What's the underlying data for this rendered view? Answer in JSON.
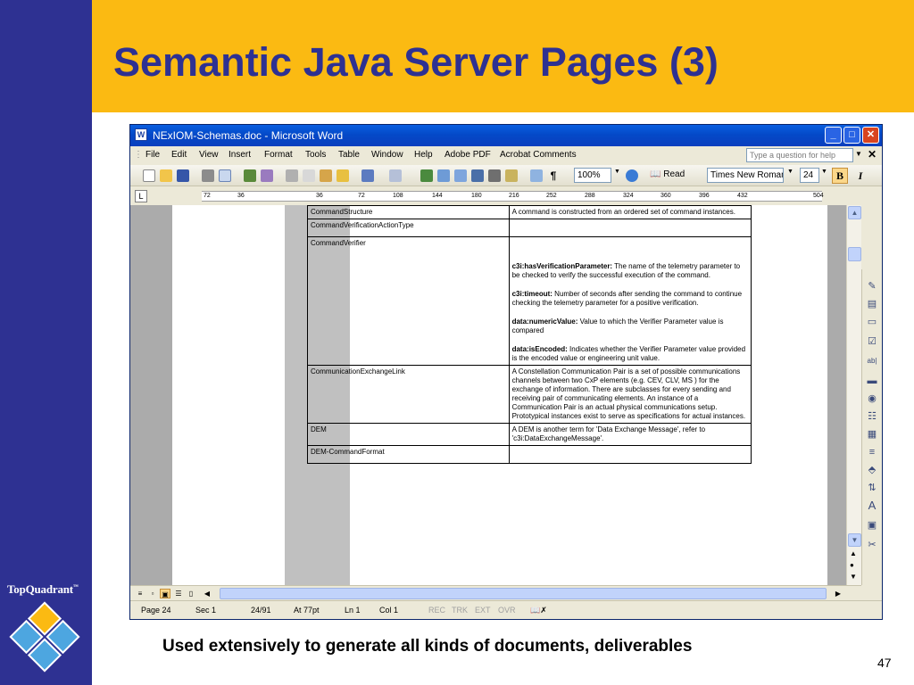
{
  "slide": {
    "title": "Semantic Java Server Pages (3)",
    "caption": "Used extensively to generate all kinds of documents, deliverables",
    "page_number": "47",
    "logo_text": "TopQuadrant",
    "logo_tm": "™"
  },
  "colors": {
    "sidebar": "#2e3192",
    "title_band": "#fbba12",
    "title_text": "#2e3192"
  },
  "word": {
    "window_title": "NExIOM-Schemas.doc - Microsoft Word",
    "window_controls": [
      "_",
      "□",
      "✕"
    ],
    "menu": [
      "File",
      "Edit",
      "View",
      "Insert",
      "Format",
      "Tools",
      "Table",
      "Window",
      "Help",
      "Adobe PDF",
      "Acrobat Comments"
    ],
    "help_placeholder": "Type a question for help",
    "zoom": "100%",
    "read_label": "Read",
    "font_name": "Times New Roman",
    "font_size": "24",
    "bold_label": "B",
    "italic_label": "I",
    "ruler_marks": [
      "72",
      "36",
      "36",
      "72",
      "108",
      "144",
      "180",
      "216",
      "252",
      "288",
      "324",
      "360",
      "396",
      "432",
      "504"
    ],
    "table_rows": [
      {
        "term": "CommandStructure",
        "desc": [
          {
            "text": "A command is constructed from an ordered set of command instances."
          }
        ]
      },
      {
        "term": "CommandVerificationActionType",
        "desc": []
      },
      {
        "term": "CommandVerifier",
        "desc": [
          {
            "bold": "c3i:hasVerificationParameter:",
            "text": " The name of the telemetry parameter to be checked to verify the successful execution of the command."
          },
          {
            "bold": "c3i:timeout:",
            "text": " Number of seconds after sending the command to continue checking the telemetry parameter for a positive verification."
          },
          {
            "bold": "data:numericValue:",
            "text": " Value to which the Verifier Parameter value is compared"
          },
          {
            "bold": "data:isEncoded:",
            "text": " Indicates whether the Verifier Parameter value provided is the encoded value or engineering unit value."
          }
        ]
      },
      {
        "term": "CommunicationExchangeLink",
        "desc": [
          {
            "text": "A Constellation Communication Pair is a set of possible communications channels between two CxP elements (e.g. CEV, CLV, MS ) for the exchange of information. There are subclasses for every sending and receiving pair of communicating elements. An instance of a Communication Pair is an actual physical communications setup. Prototypical instances exist to serve as specifications for actual instances."
          }
        ]
      },
      {
        "term": "DEM",
        "desc": [
          {
            "text": "A DEM is another term for 'Data Exchange Message', refer to 'c3i:DataExchangeMessage'."
          }
        ]
      },
      {
        "term": "DEM-CommandFormat",
        "desc": []
      }
    ],
    "status": {
      "page": "Page  24",
      "sec": "Sec  1",
      "pages": "24/91",
      "at": "At  77pt",
      "ln": "Ln  1",
      "col": "Col  1",
      "rec": "REC",
      "trk": "TRK",
      "ext": "EXT",
      "ovr": "OVR"
    }
  }
}
